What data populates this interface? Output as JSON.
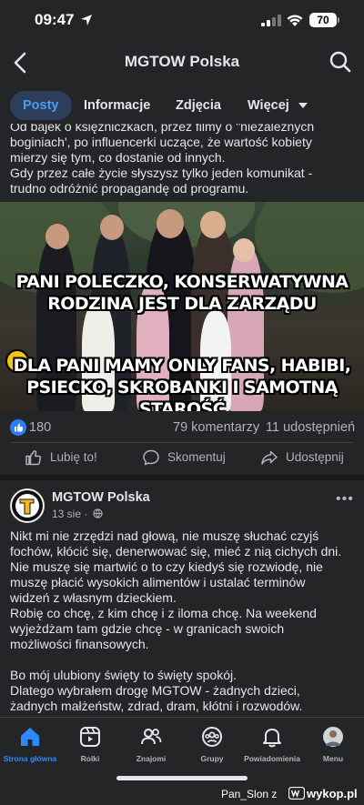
{
  "status_bar": {
    "time": "09:47",
    "battery": "70"
  },
  "header": {
    "title": "MGTOW Polska"
  },
  "tabs": [
    {
      "label": "Posty"
    },
    {
      "label": "Informacje"
    },
    {
      "label": "Zdjęcia"
    },
    {
      "label": "Więcej"
    }
  ],
  "post1": {
    "clipped_line": "Od bajek o księżniczkach, przez filmy o \"niezależnych",
    "lines": [
      "boginiach', po influencerki uczące, że wartość kobiety",
      "mierzy się tym, co dostanie od innych.",
      "Gdy przez całe życie słyszysz tylko jeden komunikat -",
      "trudno odróżnić propagandę od programu."
    ],
    "image_caption_top": [
      "PANI POLECZKO, KONSERWATYWNA",
      "RODZINA JEST DLA ZARZĄDU"
    ],
    "image_caption_bottom": [
      "DLA PANI MAMY ONLY FANS, HABIBI,",
      "PSIECKO, SKROBANKI I SAMOTNĄ STAROŚĆ"
    ],
    "reactions_count": "180",
    "comments": "79 komentarzy",
    "shares": "11 udostępnień",
    "actions": {
      "like": "Lubię to!",
      "comment": "Skomentuj",
      "share": "Udostępnij"
    }
  },
  "post2": {
    "page_name": "MGTOW Polska",
    "date": "13 sie ·",
    "paragraph1": [
      "Nikt mi nie zrzędzi nad głową, nie muszę słuchać czyjś",
      "fochów, kłócić się, denerwować się, mieć z nią cichych dni.",
      "Nie muszę się martwić o to czy kiedyś się rozwiodę, nie",
      "muszę płacić wysokich alimentów i ustalać terminów",
      "widzeń z własnym dzieckiem.",
      "Robię co chcę, z kim chcę i z iloma chcę. Na weekend",
      "wyjeżdżam tam gdzie chcę - w granicach swoich",
      "możliwości finansowych."
    ],
    "paragraph2": [
      "Bo mój ulubiony święty to święty spokój.",
      "Dlatego wybrałem drogę MGTOW - żadnych dzieci,",
      "żadnych małżeństw, zdrad, dram, kłótni i rozwodów."
    ]
  },
  "bottom_nav": [
    {
      "label": "Strona główna",
      "icon": "home-icon",
      "active": true
    },
    {
      "label": "Rolki",
      "icon": "reels-icon"
    },
    {
      "label": "Znajomi",
      "icon": "friends-icon"
    },
    {
      "label": "Grupy",
      "icon": "groups-icon"
    },
    {
      "label": "Powiadomienia",
      "icon": "bell-icon"
    },
    {
      "label": "Menu",
      "icon": "profile-menu-icon"
    }
  ],
  "watermark": {
    "user": "Pan_Slon z",
    "site": "wykop.pl"
  },
  "colors": {
    "accent": "#2e89ff",
    "background": "#242526",
    "text": "#e4e6eb",
    "muted": "#b0b3b8"
  }
}
